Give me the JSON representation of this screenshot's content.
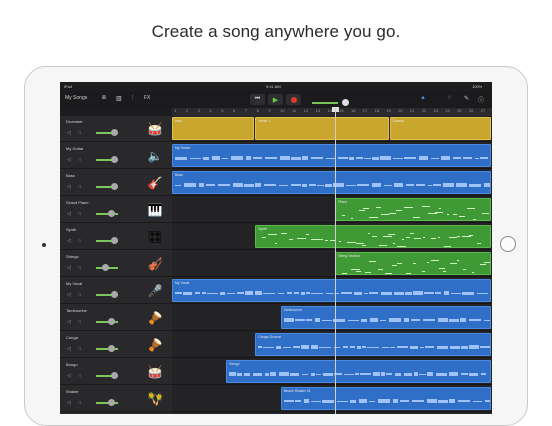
{
  "headline": "Create a song anywhere you go.",
  "status": {
    "device": "iPad",
    "time": "9:41 AM",
    "battery": "100%"
  },
  "toolbar": {
    "my_songs": "My Songs",
    "fx": "FX",
    "icons": [
      "browser-icon",
      "keyboard-icon",
      "mixer-icon",
      "rewind-icon",
      "play-icon",
      "record-icon",
      "metronome-icon",
      "loop-icon",
      "wrench-icon",
      "help-icon"
    ],
    "accent": "#3a8ff2",
    "play_color": "#5fcf3f",
    "record_color": "#e23a2f"
  },
  "ruler": [
    "1",
    "2",
    "3",
    "4",
    "5",
    "6",
    "7",
    "8",
    "9",
    "10",
    "11",
    "12",
    "13",
    "14",
    "15",
    "16",
    "17",
    "18",
    "19",
    "20",
    "21",
    "22",
    "23",
    "24",
    "25",
    "26",
    "27"
  ],
  "tracks": [
    {
      "name": "Drummer",
      "instrument": "drum-machine-icon",
      "glyph": "🥁"
    },
    {
      "name": "My Guitar",
      "instrument": "amp-icon",
      "glyph": "🔈"
    },
    {
      "name": "Bass",
      "instrument": "bass-guitar-icon",
      "glyph": "🎸"
    },
    {
      "name": "Grand Piano",
      "instrument": "piano-icon",
      "glyph": "🎹"
    },
    {
      "name": "Synth",
      "instrument": "synth-icon",
      "glyph": "🎛"
    },
    {
      "name": "Strings",
      "instrument": "strings-icon",
      "glyph": "🎻"
    },
    {
      "name": "My Vocal",
      "instrument": "microphone-icon",
      "glyph": "🎤"
    },
    {
      "name": "Tambourine",
      "instrument": "tambourine-icon",
      "glyph": "🪘"
    },
    {
      "name": "Conga",
      "instrument": "conga-icon",
      "glyph": "🪘"
    },
    {
      "name": "Bongo",
      "instrument": "bongo-icon",
      "glyph": "🥁"
    },
    {
      "name": "Shaker",
      "instrument": "shaker-icon",
      "glyph": "🪇"
    }
  ],
  "regions": [
    {
      "track": 0,
      "color": "yellow",
      "label": "Intro",
      "start": 0,
      "width": 0.26
    },
    {
      "track": 0,
      "color": "yellow",
      "label": "Verse 1",
      "start": 0.26,
      "width": 0.42
    },
    {
      "track": 0,
      "color": "yellow",
      "label": "Chorus",
      "start": 0.68,
      "width": 0.32
    },
    {
      "track": 1,
      "color": "blue",
      "label": "My Guitar",
      "start": 0,
      "width": 1.0
    },
    {
      "track": 2,
      "color": "blue",
      "label": "Bass",
      "start": 0,
      "width": 1.0
    },
    {
      "track": 3,
      "color": "green",
      "label": "Piano",
      "start": 0.51,
      "width": 0.49
    },
    {
      "track": 4,
      "color": "green",
      "label": "Synth",
      "start": 0.26,
      "width": 0.74
    },
    {
      "track": 5,
      "color": "green",
      "label": "String Section",
      "start": 0.51,
      "width": 0.49
    },
    {
      "track": 6,
      "color": "blue",
      "label": "My Vocal",
      "start": 0,
      "width": 1.0
    },
    {
      "track": 7,
      "color": "blue",
      "label": "Tambourine",
      "start": 0.34,
      "width": 0.66
    },
    {
      "track": 8,
      "color": "blue",
      "label": "Conga Groove",
      "start": 0.26,
      "width": 0.74
    },
    {
      "track": 9,
      "color": "blue",
      "label": "Bongo",
      "start": 0.17,
      "width": 0.83
    },
    {
      "track": 10,
      "color": "blue",
      "label": "Beach Shaker 01",
      "start": 0.34,
      "width": 0.66
    }
  ]
}
